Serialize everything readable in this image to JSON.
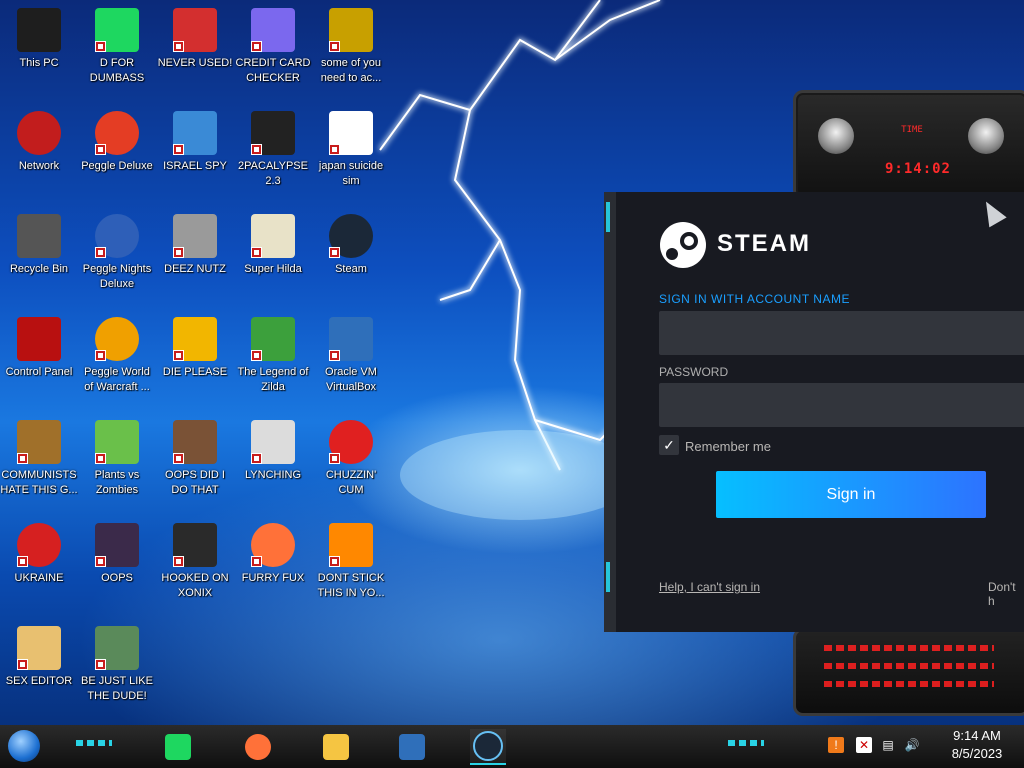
{
  "desktop": {
    "icons": [
      {
        "label": "This PC",
        "icon": "monitor-icon",
        "color": "#1e1e1e"
      },
      {
        "label": "D FOR DUMBASS",
        "icon": "spotify-icon",
        "color": "#1ed760"
      },
      {
        "label": "NEVER USED!",
        "icon": "dev-cpp-icon",
        "color": "#d32f2f"
      },
      {
        "label": "CREDIT CARD CHECKER",
        "icon": "credit-card-icon",
        "color": "#7b68ee"
      },
      {
        "label": "some of you need to ac...",
        "icon": "bear-pixel-icon",
        "color": "#c8a000"
      },
      {
        "label": "Network",
        "icon": "network-icon",
        "color": "#c21d1d"
      },
      {
        "label": "Peggle Deluxe",
        "icon": "peggle-icon",
        "color": "#e43d24"
      },
      {
        "label": "ISRAEL SPY",
        "icon": "spy-icon",
        "color": "#3a8ad6"
      },
      {
        "label": "2PACALYPSE 2.3",
        "icon": "terminal-icon",
        "color": "#222222"
      },
      {
        "label": "japan suicide sim",
        "icon": "japan-sim-icon",
        "color": "#ffffff"
      },
      {
        "label": "Recycle Bin",
        "icon": "recycle-bin-icon",
        "color": "#555555"
      },
      {
        "label": "Peggle Nights Deluxe",
        "icon": "peggle-nights-icon",
        "color": "#2e5fb8"
      },
      {
        "label": "DEEZ NUTZ",
        "icon": "stacked-windows-icon",
        "color": "#9a9a9a"
      },
      {
        "label": "Super Hilda",
        "icon": "hilda-icon",
        "color": "#e8e2c8"
      },
      {
        "label": "Steam",
        "icon": "steam-icon",
        "color": "#1b2838"
      },
      {
        "label": "Control Panel",
        "icon": "control-panel-icon",
        "color": "#b81010"
      },
      {
        "label": "Peggle World of Warcraft ...",
        "icon": "peggle-wow-icon",
        "color": "#f0a000"
      },
      {
        "label": "DIE PLEASE",
        "icon": "de-icon",
        "color": "#f2b600"
      },
      {
        "label": "The Legend of Zilda",
        "icon": "zilda-icon",
        "color": "#3ca03c"
      },
      {
        "label": "Oracle VM VirtualBox",
        "icon": "virtualbox-icon",
        "color": "#2f6fba"
      },
      {
        "label": "COMMUNISTS HATE THIS G...",
        "icon": "money-bag-icon",
        "color": "#a0702a"
      },
      {
        "label": "Plants vs Zombies",
        "icon": "flower-icon",
        "color": "#6ac04a"
      },
      {
        "label": "OOPS DID I DO THAT",
        "icon": "portrait-icon",
        "color": "#7a5236"
      },
      {
        "label": "LYNCHING",
        "icon": "rope-icon",
        "color": "#dcdcdc"
      },
      {
        "label": "CHUZZIN' CUM",
        "icon": "chuzzle-icon",
        "color": "#e02020"
      },
      {
        "label": "UKRAINE",
        "icon": "radiation-icon",
        "color": "#d62020"
      },
      {
        "label": "OOPS",
        "icon": "book-icon",
        "color": "#3b2a4a"
      },
      {
        "label": "HOOKED ON XONIX",
        "icon": "xonix-icon",
        "color": "#2a2a2a"
      },
      {
        "label": "FURRY FUX",
        "icon": "firefox-icon",
        "color": "#ff7139"
      },
      {
        "label": "DONT STICK THIS IN YO...",
        "icon": "vlc-icon",
        "color": "#ff8800"
      },
      {
        "label": "SEX EDITOR",
        "icon": "hxd-icon",
        "color": "#e8c070"
      },
      {
        "label": "BE JUST LIKE THE DUDE!",
        "icon": "dude-icon",
        "color": "#5a8a5a"
      }
    ]
  },
  "widget": {
    "time_label": "TIME",
    "time_value": "9:14:02"
  },
  "steam_login": {
    "brand": "STEAM",
    "account_label": "SIGN IN WITH ACCOUNT NAME",
    "account_value": "",
    "password_label": "PASSWORD",
    "password_value": "",
    "remember_label": "Remember me",
    "remember_checked": true,
    "signin_label": "Sign in",
    "help_link": "Help, I can't sign in",
    "dont_have": "Don't h"
  },
  "taskbar": {
    "apps": [
      {
        "name": "spotify-icon",
        "color": "#1ed760"
      },
      {
        "name": "firefox-icon",
        "color": "#ff7139"
      },
      {
        "name": "file-explorer-icon",
        "color": "#f5c542"
      },
      {
        "name": "virtualbox-icon",
        "color": "#2f6fba"
      },
      {
        "name": "steam-icon",
        "color": "#1b2838"
      }
    ],
    "clock_time": "9:14 AM",
    "clock_date": "8/5/2023"
  }
}
